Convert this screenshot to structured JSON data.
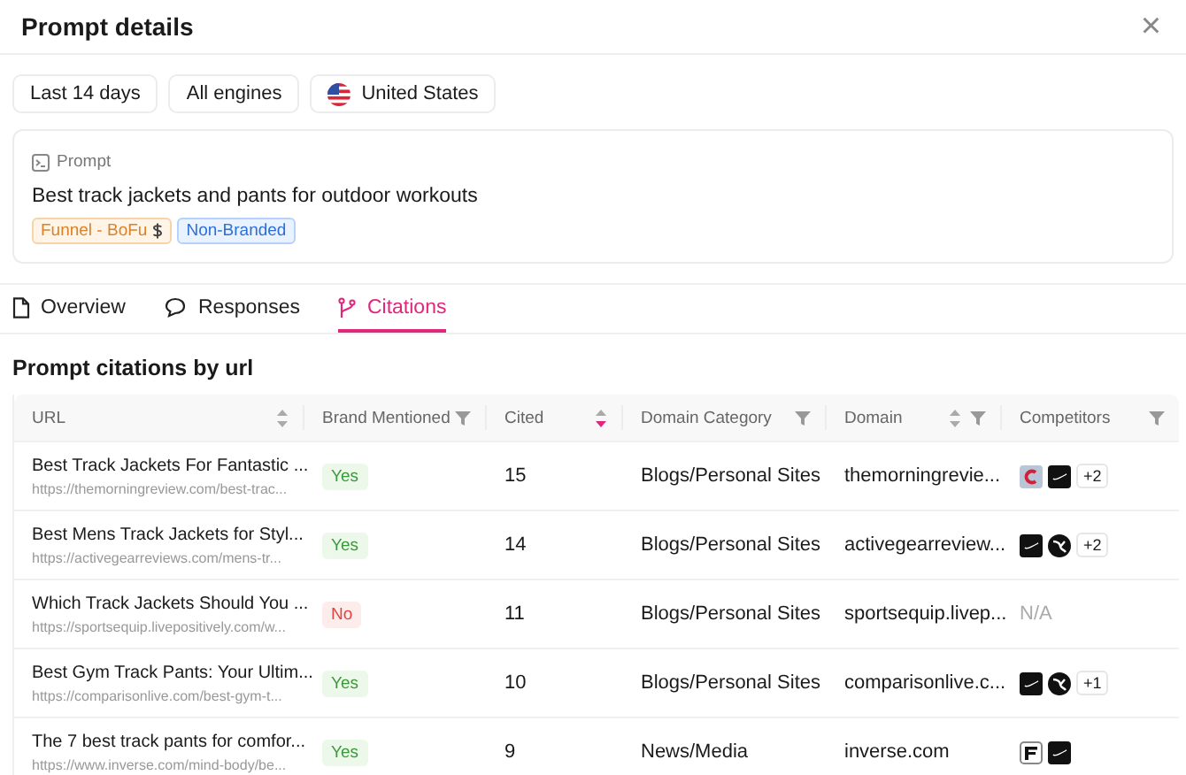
{
  "header": {
    "title": "Prompt details",
    "close": "×"
  },
  "filters": [
    {
      "label": "Last 14 days",
      "flag": false
    },
    {
      "label": "All engines",
      "flag": false
    },
    {
      "label": "United States",
      "flag": true
    }
  ],
  "prompt": {
    "label": "Prompt",
    "text": "Best track jackets and pants for outdoor workouts",
    "tags": [
      {
        "label": "Funnel - BoFu",
        "kind": "funnel"
      },
      {
        "label": "Non-Branded",
        "kind": "branded"
      }
    ]
  },
  "tabs": [
    {
      "label": "Overview",
      "selected": false
    },
    {
      "label": "Responses",
      "selected": false
    },
    {
      "label": "Citations",
      "selected": true
    }
  ],
  "section_title": "Prompt citations by url",
  "table": {
    "columns": [
      {
        "label": "URL",
        "sortable": true,
        "sorted": false,
        "filter": false
      },
      {
        "label": "Brand Mentioned",
        "sortable": false,
        "filter": true
      },
      {
        "label": "Cited",
        "sortable": true,
        "sorted": true,
        "filter": false
      },
      {
        "label": "Domain Category",
        "sortable": false,
        "filter": true
      },
      {
        "label": "Domain",
        "sortable": true,
        "sorted": false,
        "filter": true
      },
      {
        "label": "Competitors",
        "sortable": false,
        "filter": true
      }
    ],
    "rows": [
      {
        "title": "Best Track Jackets For Fantastic ...",
        "url": "https://themorningreview.com/best-trac...",
        "mentioned": {
          "label": "Yes",
          "value": true
        },
        "cited": "15",
        "category": "Blogs/Personal Sites",
        "domain": "themorningrevie...",
        "competitors": [
          {
            "kind": "crescent"
          },
          {
            "kind": "tick"
          }
        ],
        "more": "+2"
      },
      {
        "title": "Best Mens Track Jackets for Styl...",
        "url": "https://activegearreviews.com/mens-tr...",
        "mentioned": {
          "label": "Yes",
          "value": true
        },
        "cited": "14",
        "category": "Blogs/Personal Sites",
        "domain": "activegearreview...",
        "competitors": [
          {
            "kind": "tick"
          },
          {
            "kind": "cat"
          }
        ],
        "more": "+2"
      },
      {
        "title": "Which Track Jackets Should You ...",
        "url": "https://sportsequip.livepositively.com/w...",
        "mentioned": {
          "label": "No",
          "value": false
        },
        "cited": "11",
        "category": "Blogs/Personal Sites",
        "domain": "sportsequip.livep...",
        "na": "N/A"
      },
      {
        "title": "Best Gym Track Pants: Your Ultim...",
        "url": "https://comparisonlive.com/best-gym-t...",
        "mentioned": {
          "label": "Yes",
          "value": true
        },
        "cited": "10",
        "category": "Blogs/Personal Sites",
        "domain": "comparisonlive.c...",
        "competitors": [
          {
            "kind": "tick"
          },
          {
            "kind": "cat"
          }
        ],
        "more": "+1"
      },
      {
        "title": "The 7 best track pants for comfor...",
        "url": "https://www.inverse.com/mind-body/be...",
        "mentioned": {
          "label": "Yes",
          "value": true
        },
        "cited": "9",
        "category": "News/Media",
        "domain": "inverse.com",
        "competitors": [
          {
            "kind": "letter"
          },
          {
            "kind": "tick"
          }
        ]
      }
    ]
  }
}
